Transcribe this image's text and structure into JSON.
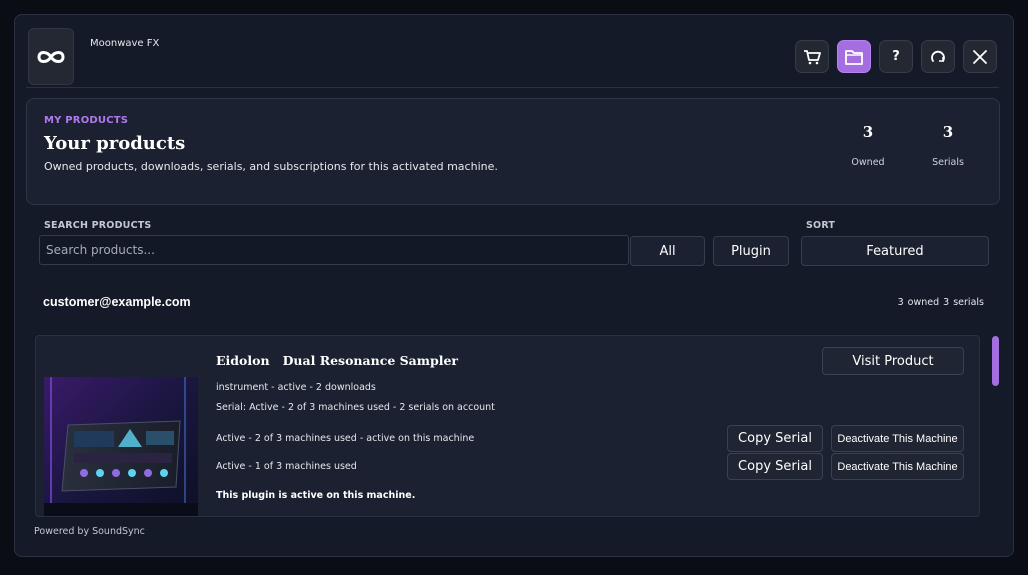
{
  "app": {
    "title": "Moonwave FX",
    "logo_icon": "infinity-icon"
  },
  "toolbar": {
    "buttons": [
      {
        "name": "cart-button",
        "icon": "cart-icon",
        "label": ""
      },
      {
        "name": "folder-button",
        "icon": "folder-icon",
        "label": "",
        "active": true
      },
      {
        "name": "help-button",
        "icon": "question-icon",
        "label": "?"
      },
      {
        "name": "refresh-button",
        "icon": "refresh-icon",
        "label": ""
      },
      {
        "name": "close-button",
        "icon": "close-icon",
        "label": ""
      }
    ]
  },
  "products_panel": {
    "kicker": "MY PRODUCTS",
    "title": "Your products",
    "description": "Owned products, downloads, serials, and subscriptions for this activated machine.",
    "stats": [
      {
        "value": "3",
        "label": "Owned"
      },
      {
        "value": "3",
        "label": "Serials"
      }
    ]
  },
  "search": {
    "label": "SEARCH PRODUCTS",
    "placeholder": "Search products..."
  },
  "filters": [
    {
      "label": "All"
    },
    {
      "label": "Plugin"
    }
  ],
  "sort": {
    "label": "SORT",
    "selected": "Featured"
  },
  "account": {
    "email": "customer@example.com",
    "summary": "3 owned   3 serials"
  },
  "product": {
    "name": "Eidolon   Dual Resonance Sampler",
    "meta": "instrument - active - 2 downloads",
    "serial_line": "Serial: Active - 2 of 3 machines used - 2 serials on account",
    "visit_label": "Visit Product",
    "activations": [
      {
        "text": "Active - 2 of 3 machines used - active on this machine",
        "copy_label": "Copy Serial",
        "deactivate_label": "Deactivate This Machine"
      },
      {
        "text": "Active - 1 of 3 machines used",
        "copy_label": "Copy Serial",
        "deactivate_label": "Deactivate This Machine"
      }
    ],
    "status_note": "This plugin is active on this machine."
  },
  "footer": {
    "text": "Powered by SoundSync"
  },
  "colors": {
    "accent": "#a56ee0",
    "background": "#0b0d14",
    "panel": "#1b2130",
    "window": "#141a27"
  }
}
